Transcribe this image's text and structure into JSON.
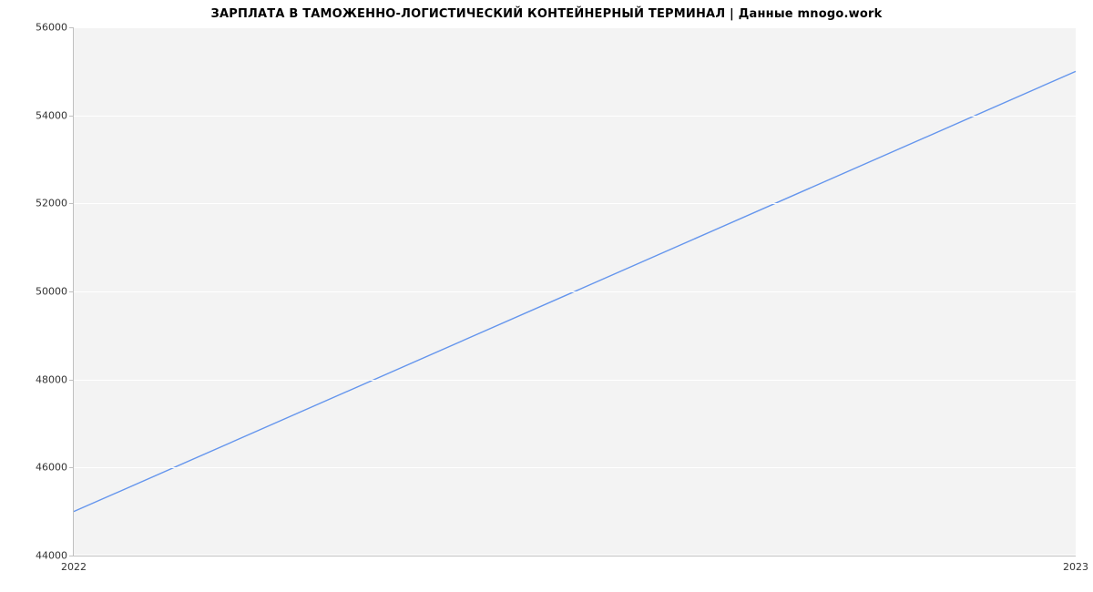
{
  "chart_data": {
    "type": "line",
    "title": "ЗАРПЛАТА В  ТАМОЖЕННО-ЛОГИСТИЧЕСКИЙ КОНТЕЙНЕРНЫЙ ТЕРМИНАЛ | Данные mnogo.work",
    "x": [
      2022,
      2023
    ],
    "y": [
      45000,
      55000
    ],
    "xlim": [
      2022,
      2023
    ],
    "ylim": [
      44000,
      56000
    ],
    "x_ticks": [
      2022,
      2023
    ],
    "y_ticks": [
      44000,
      46000,
      48000,
      50000,
      52000,
      54000,
      56000
    ],
    "xlabel": "",
    "ylabel": "",
    "grid": true
  }
}
